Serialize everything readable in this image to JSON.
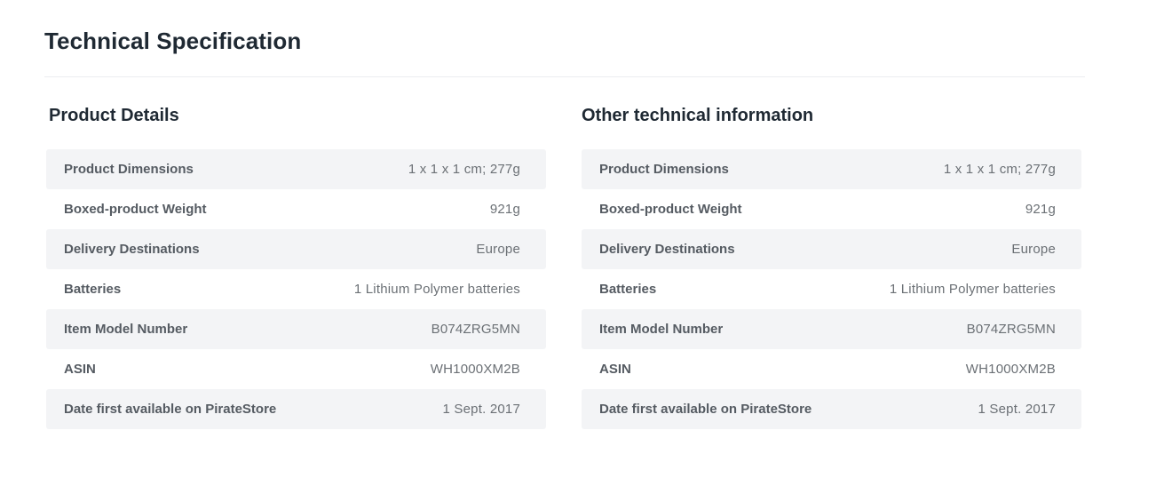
{
  "page_title": "Technical Specification",
  "panels": {
    "left": {
      "title": "Product Details",
      "rows": [
        {
          "label": "Product Dimensions",
          "value": "1 x 1 x 1 cm; 277g"
        },
        {
          "label": "Boxed-product Weight",
          "value": "921g"
        },
        {
          "label": "Delivery Destinations",
          "value": "Europe"
        },
        {
          "label": "Batteries",
          "value": "1 Lithium Polymer batteries"
        },
        {
          "label": "Item Model Number",
          "value": "B074ZRG5MN"
        },
        {
          "label": "ASIN",
          "value": "WH1000XM2B"
        },
        {
          "label": "Date first available on PirateStore",
          "value": "1 Sept. 2017"
        }
      ]
    },
    "right": {
      "title": "Other technical information",
      "rows": [
        {
          "label": "Product Dimensions",
          "value": "1 x 1 x 1 cm; 277g"
        },
        {
          "label": "Boxed-product Weight",
          "value": "921g"
        },
        {
          "label": "Delivery Destinations",
          "value": "Europe"
        },
        {
          "label": "Batteries",
          "value": "1 Lithium Polymer batteries"
        },
        {
          "label": "Item Model Number",
          "value": "B074ZRG5MN"
        },
        {
          "label": "ASIN",
          "value": "WH1000XM2B"
        },
        {
          "label": "Date first available on PirateStore",
          "value": "1 Sept. 2017"
        }
      ]
    }
  }
}
